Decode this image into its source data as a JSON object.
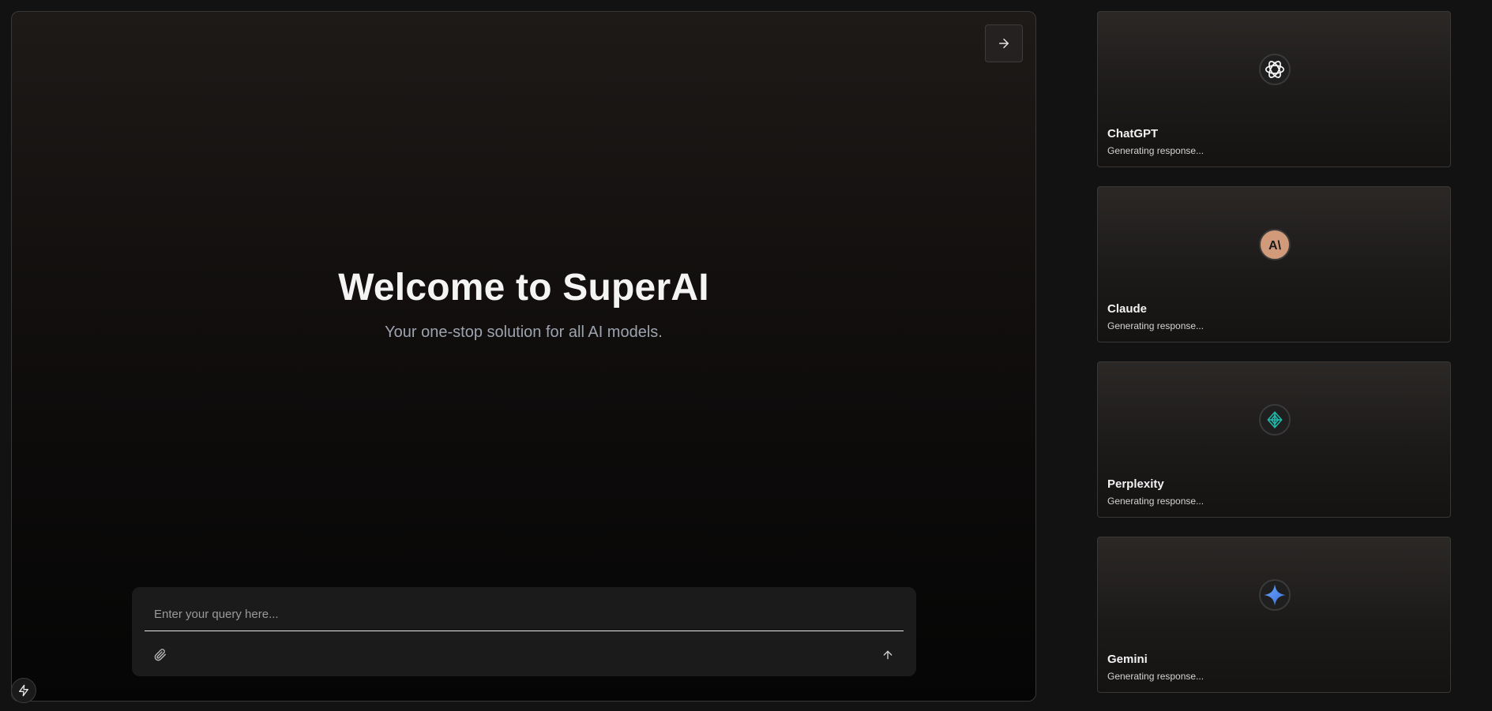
{
  "main": {
    "title": "Welcome to SuperAI",
    "subtitle": "Your one-stop solution for all AI models.",
    "query_placeholder": "Enter your query here..."
  },
  "icons": {
    "expand": "arrow-right-icon",
    "attach": "paperclip-icon",
    "send": "arrow-up-icon",
    "bolt": "lightning-icon"
  },
  "models": [
    {
      "name": "ChatGPT",
      "status": "Generating response...",
      "icon": "chatgpt-logo-icon",
      "color": "#ffffff"
    },
    {
      "name": "Claude",
      "status": "Generating response...",
      "icon": "claude-logo-icon",
      "color": "#d19a7a"
    },
    {
      "name": "Perplexity",
      "status": "Generating response...",
      "icon": "perplexity-logo-icon",
      "color": "#20b8a8"
    },
    {
      "name": "Gemini",
      "status": "Generating response...",
      "icon": "gemini-logo-icon",
      "color": "#4a8df0"
    }
  ]
}
